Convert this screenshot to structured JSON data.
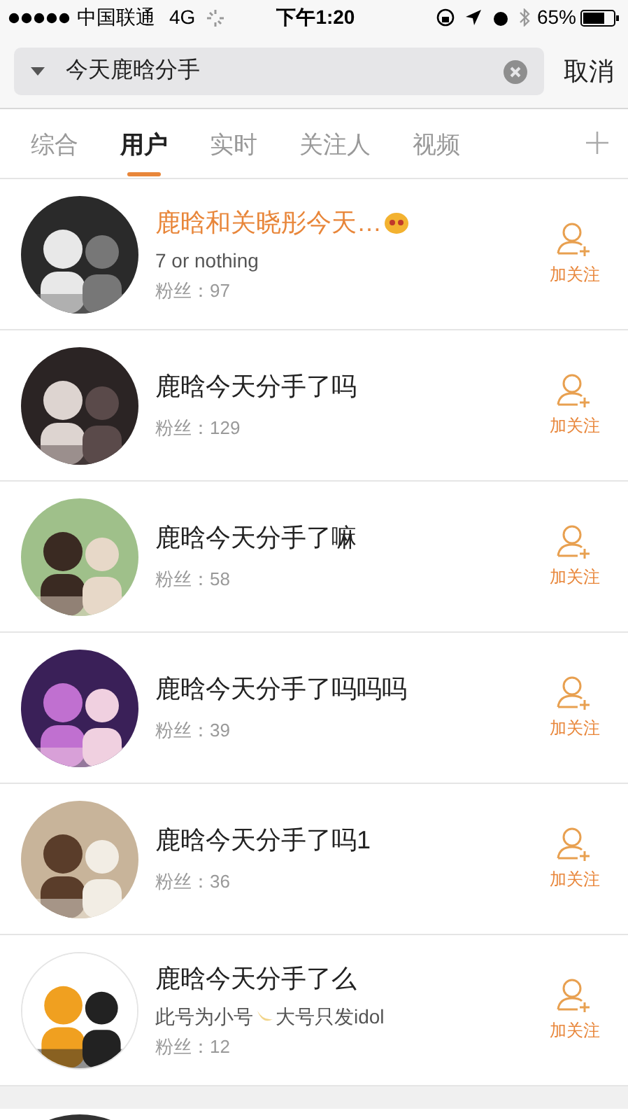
{
  "status_bar": {
    "carrier": "中国联通",
    "network": "4G",
    "time": "下午1:20",
    "battery": "65%"
  },
  "search": {
    "value": "今天鹿晗分手",
    "cancel": "取消"
  },
  "tabs": [
    {
      "label": "综合",
      "selected": false
    },
    {
      "label": "用户",
      "selected": true
    },
    {
      "label": "实时",
      "selected": false
    },
    {
      "label": "关注人",
      "selected": false
    },
    {
      "label": "视频",
      "selected": false
    }
  ],
  "users": [
    {
      "name": "鹿晗和关晓彤今天…",
      "highlighted": true,
      "emoji": true,
      "bio": [
        "7 or nothing"
      ],
      "followers": "粉丝：97",
      "follow": "加关注"
    },
    {
      "name": "鹿晗今天分手了吗",
      "highlighted": false,
      "emoji": false,
      "followers": "粉丝：129",
      "follow": "加关注"
    },
    {
      "name": "鹿晗今天分手了嘛",
      "highlighted": false,
      "emoji": false,
      "followers": "粉丝：58",
      "follow": "加关注"
    },
    {
      "name": "鹿晗今天分手了吗吗吗",
      "highlighted": false,
      "emoji": false,
      "followers": "粉丝：39",
      "follow": "加关注"
    },
    {
      "name": "鹿晗今天分手了吗1",
      "highlighted": false,
      "emoji": false,
      "followers": "粉丝：36",
      "follow": "加关注"
    },
    {
      "name": "鹿晗今天分手了么",
      "highlighted": false,
      "emoji": false,
      "bio": [
        "此号为小号",
        "大号只发idol"
      ],
      "followers": "粉丝：12",
      "follow": "加关注"
    }
  ]
}
